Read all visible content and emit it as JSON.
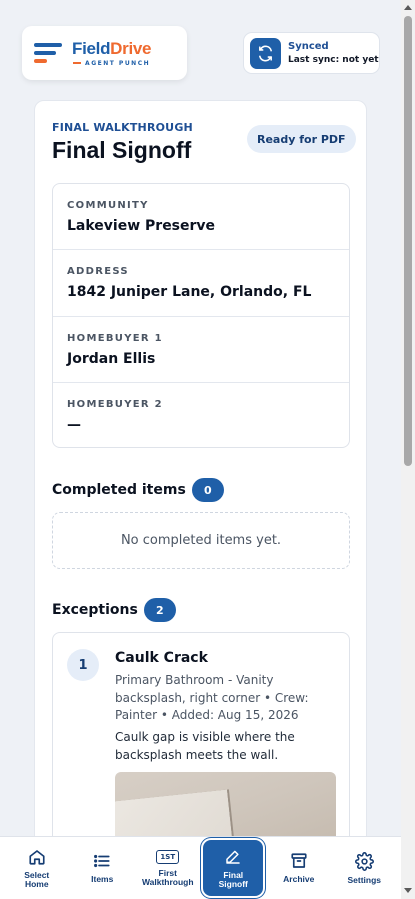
{
  "header": {
    "brand_first": "Field",
    "brand_second": "Drive",
    "tagline": "AGENT PUNCH",
    "sync_status": "Synced",
    "sync_detail": "Last sync: not yet"
  },
  "page": {
    "eyebrow": "FINAL WALKTHROUGH",
    "title": "Final Signoff",
    "status": "Ready for PDF"
  },
  "info": [
    {
      "label": "COMMUNITY",
      "value": "Lakeview Preserve"
    },
    {
      "label": "ADDRESS",
      "value": "1842 Juniper Lane, Orlando, FL"
    },
    {
      "label": "HOMEBUYER 1",
      "value": "Jordan Ellis"
    },
    {
      "label": "HOMEBUYER 2",
      "value": "—"
    }
  ],
  "completed": {
    "title": "Completed items",
    "count": "0",
    "empty_text": "No completed items yet."
  },
  "exceptions": {
    "title": "Exceptions",
    "count": "2",
    "items": [
      {
        "number": "1",
        "title": "Caulk Crack",
        "meta": "Primary Bathroom - Vanity backsplash, right corner • Crew: Painter • Added: Aug 15, 2026",
        "description": "Caulk gap is visible where the backsplash meets the wall."
      }
    ]
  },
  "nav": {
    "select_home": "Select Home",
    "items": "Items",
    "first_walkthrough_badge": "1ST",
    "first_walkthrough": "First Walkthrough",
    "final_signoff": "Final Signoff",
    "archive": "Archive",
    "settings": "Settings"
  },
  "colors": {
    "primary": "#1f5fa8",
    "accent": "#ef6a2f"
  }
}
